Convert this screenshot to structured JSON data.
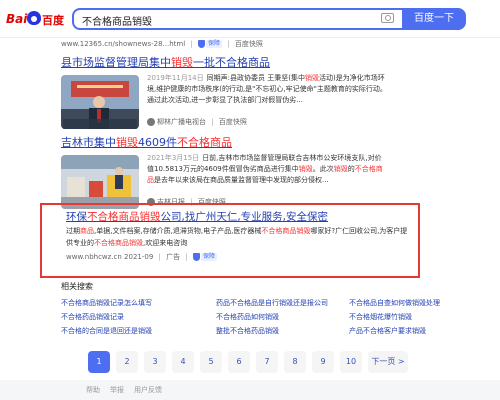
{
  "header": {
    "logo_text_left": "Bai",
    "logo_text_right": "百度",
    "query": "不合格商品销毁",
    "search_button": "百度一下"
  },
  "top_url": {
    "url": "www.12365.cn/shownews-28...html",
    "badge": "保障",
    "snapshot": "百度快照"
  },
  "result1": {
    "title_pre": "县市场监督管理局集中",
    "title_hl": "销毁",
    "title_post": "一批不合格商品",
    "date": "2019年11月14日",
    "abstract_pre": "同期声:县政协委员 王秉坚(集中",
    "abstract_hl": "销毁",
    "abstract_post": "活动)是为净化市场环境,维护健康的市场秩序(的行动,是\"不忘初心,牢记使命\"主题教育的实际行动。通过此次活动,进一步彰显了执法部门对假冒伪劣...",
    "source": "柳林广播电视台",
    "snapshot": "百度快照"
  },
  "result2": {
    "title_pre": "吉林市集中",
    "title_hl": "销毁",
    "title_mid": "4609件",
    "title_hl2": "不合格商品",
    "date": "2021年3月15日",
    "abstract_pre": "日前,吉林市市场监督管理局联合吉林市公安环境支队,对价值10.5813万元的4609件假冒伪劣商品进行集中",
    "abstract_hl": "销毁",
    "abstract_mid": "。此次",
    "abstract_hl2": "销毁",
    "abstract_mid2": "的",
    "abstract_hl3": "不合格商品",
    "abstract_post": "是去年以来该局在商品质量监督管理中发现的部分侵权...",
    "source": "吉林日报",
    "snapshot": "百度快照"
  },
  "ad": {
    "title_pre": "环保",
    "title_hl": "不合格商品销毁",
    "title_post": "公司,找广州天仁,专业服务,安全保密",
    "abstract_pre": "过期",
    "abstract_hl": "商品",
    "abstract_mid": ",单据,文件档案,存储介质,退滞货物,电子产品,医疗器械",
    "abstract_hl2": "不合格商品销毁",
    "abstract_mid2": "哪家好?广仁回收公司,为客户提供专业的",
    "abstract_hl3": "不合格商品销毁",
    "abstract_post": ",欢迎来电咨询",
    "url": "www.nbhcwz.cn 2021-09",
    "ad_label": "广告",
    "badge": "保障"
  },
  "related": {
    "heading": "相关搜索",
    "items": [
      "不合格商品销毁记录怎么填写",
      "药品不合格品是自行销毁还是报公司",
      "不合格品自查如何做销毁处理",
      "不合格药品销毁记录",
      "不合格药品如何销毁",
      "不合格烟花爆竹销毁",
      "不合格的合同是退回还是销毁",
      "整批不合格药品销毁",
      "产品不合格客户要求销毁"
    ]
  },
  "pager": {
    "pages": [
      "1",
      "2",
      "3",
      "4",
      "5",
      "6",
      "7",
      "8",
      "9",
      "10"
    ],
    "current": "1",
    "next": "下一页 >"
  },
  "footer": {
    "links": [
      "帮助",
      "举报",
      "用户反馈"
    ]
  },
  "colors": {
    "brand_blue": "#4e6ef2",
    "link_blue": "#2440b3",
    "highlight_red": "#f73131",
    "ad_border": "#e53935"
  }
}
